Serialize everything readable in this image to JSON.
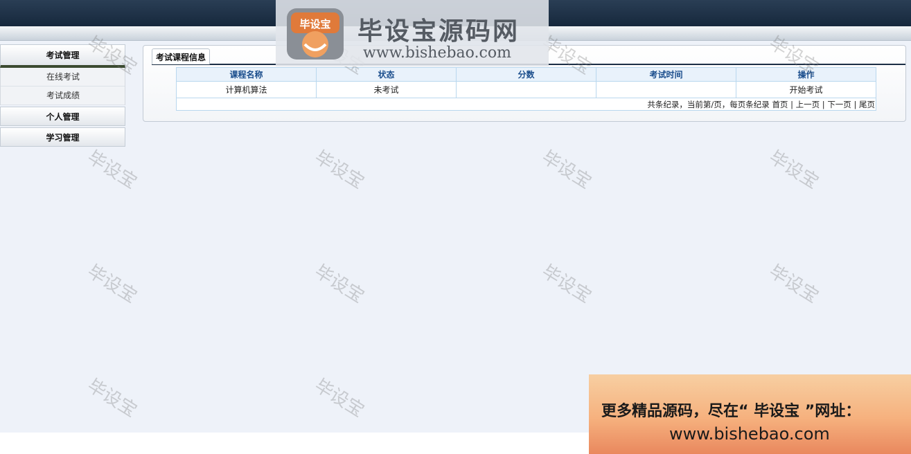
{
  "logo": {
    "badge_text": "毕设宝",
    "title": "毕设宝源码网",
    "url": "www.bishebao.com"
  },
  "sidebar": {
    "sections": [
      {
        "label": "考试管理",
        "active": true,
        "items": [
          "在线考试",
          "考试成绩"
        ]
      },
      {
        "label": "个人管理",
        "active": false,
        "items": []
      },
      {
        "label": "学习管理",
        "active": false,
        "items": []
      }
    ]
  },
  "panel": {
    "tab_label": "考试课程信息",
    "columns": [
      "课程名称",
      "状态",
      "分数",
      "考试时间",
      "操作"
    ],
    "rows": [
      [
        "计算机算法",
        "未考试",
        "",
        "",
        "开始考试"
      ]
    ],
    "pager": {
      "summary": "共条纪录，当前第/页，每页条纪录",
      "first": "首页",
      "prev": "上一页",
      "next": "下一页",
      "last": "尾页",
      "separator": "|"
    }
  },
  "watermark": {
    "text": "毕设宝"
  },
  "promo": {
    "line1": "更多精品源码，尽在“ 毕设宝 ”网址：",
    "line2": "www.bishebao.com"
  },
  "colors": {
    "header_dark": "#16283c",
    "table_header_text": "#1a4d8c",
    "table_border": "#b9d7ee",
    "content_bg": "#eef2f9"
  }
}
